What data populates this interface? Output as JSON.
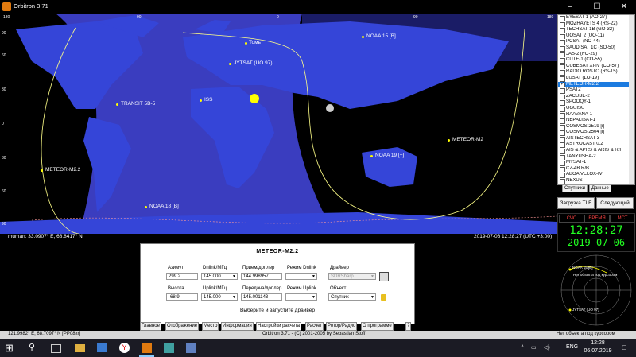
{
  "window": {
    "title": "Orbitron 3.71"
  },
  "map": {
    "lat_labels": [
      "90",
      "60",
      "30",
      "0",
      "30",
      "60",
      "90"
    ],
    "lon_labels": [
      "180",
      "90",
      "0",
      "90",
      "180"
    ],
    "satellites": [
      {
        "label": "NOAA 15 [B]"
      },
      {
        "label": "Томь"
      },
      {
        "label": "JYTSAT (UO 97)"
      },
      {
        "label": "ISS"
      },
      {
        "label": "TRANSIT 5B-5"
      },
      {
        "label": "METEOR-M2"
      },
      {
        "label": "METEOR-M2.2"
      },
      {
        "label": "NOAA 19 [+]"
      },
      {
        "label": "NOAA 18 [B]"
      }
    ],
    "coords_left": "muman: 33.0907° E, 68.8417° N",
    "coords_right": "2019-07-06 12:28:27 (UTC +3:00)"
  },
  "sat_list": {
    "items": [
      "EYESAT-1 (AO-27)",
      "MOZHAYETS 4 (RS-22)",
      "TECHSAT 1B (GO-32)",
      "UOSAT 2 (UO-11)",
      "PCSAT (NO-44)",
      "SAUDISAT 1C (SO-50)",
      "JAS-2 (FO-29)",
      "CUTE-1 (CO-55)",
      "CUBESAT XI-IV (CO-57)",
      "RADIO ROSTO (RS-15)",
      "LUSAT (LO-19)",
      "METEOR-M2.2",
      "PSAT2",
      "ZACUBE-2",
      "SPOOQY-1",
      "UGUISU",
      "RAAVANA-1",
      "NEPALISAT-1",
      "COSMOS 2519 [i]",
      "COSMOS 2504 [i]",
      "AISTECHSAT 3",
      "ASTROCAST 0.2",
      "AIS & APRS & ARIS & R/I",
      "TANYUSHA-2",
      "MYSAT-1",
      "CZ-4B R/B",
      "ABOA VELOX-IV",
      "NEXUS"
    ],
    "selected": "METEOR-M2.2",
    "tabs": [
      "Спутники",
      "Данные"
    ],
    "load_tle": "Загрузка TLE",
    "next": "Следующий"
  },
  "clock": {
    "headers": [
      "СЧС",
      "ВРЕМЯ",
      "МСТ"
    ],
    "time": "12:28:27",
    "date": "2019-07-06"
  },
  "radar": {
    "labels": [
      "NOAA 15 [B]",
      "Нет объекта под курсором",
      "JYTSAT (UO 97)"
    ]
  },
  "panel": {
    "title": "METEOR-M2.2",
    "azimuth_label": "Азимут",
    "azimuth": "299.2",
    "elevation_label": "Высота",
    "elevation": "-68.9",
    "dnlink_label": "Dnlink/МГц",
    "dnlink": "145.000",
    "uplink_label": "Uplink/МГц",
    "uplink": "145.000",
    "rx_label": "Прием/доплер",
    "rx": "144.998957",
    "tx_label": "Передача/доплер",
    "tx": "145.001143",
    "mode_dn_label": "Режим Dnlink",
    "mode_dn": "",
    "mode_up_label": "Режим Uplink",
    "mode_up": "",
    "driver_label": "Драйвер",
    "driver": "SDRSharp",
    "object_label": "Объект",
    "object": "Спутник",
    "hint": "Выберите и запустите драйвер"
  },
  "tabs": [
    "Главное",
    "Отображение",
    "Место",
    "Информация",
    "Настройки расчета",
    "Расчет",
    "Ротор/Радио",
    "О программе",
    "?"
  ],
  "statusbar": {
    "left": "121.9982° E, 68.7097° N [PP08xr]",
    "center": "Orbitron 3.71 - (C) 2001-2005 by Sebastian Stoff",
    "right": "Нет объекта под курсором"
  },
  "taskbar": {
    "lang": "ENG",
    "time": "12:28",
    "date": "06.07.2019"
  }
}
